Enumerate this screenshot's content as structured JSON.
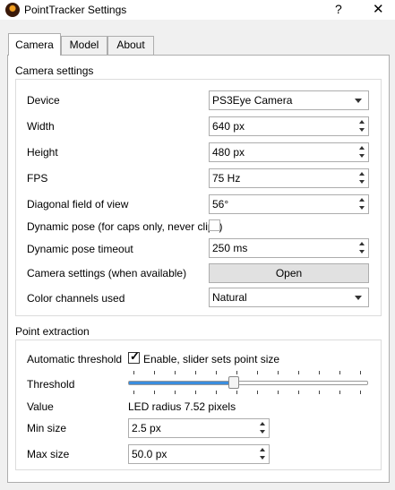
{
  "window": {
    "title": "PointTracker Settings",
    "help": "?",
    "close": "✕"
  },
  "tabs": [
    "Camera",
    "Model",
    "About"
  ],
  "camera": {
    "group_title": "Camera settings",
    "device": {
      "label": "Device",
      "value": "PS3Eye Camera"
    },
    "width": {
      "label": "Width",
      "value": "640 px"
    },
    "height": {
      "label": "Height",
      "value": "480 px"
    },
    "fps": {
      "label": "FPS",
      "value": "75 Hz"
    },
    "fov": {
      "label": "Diagonal field of view",
      "value": "56°"
    },
    "dynamic_pose": {
      "label": "Dynamic pose (for caps only, never clips)",
      "checked": false
    },
    "dynamic_pose_timeout": {
      "label": "Dynamic pose timeout",
      "value": "250 ms"
    },
    "camera_settings": {
      "label": "Camera settings (when available)",
      "button": "Open"
    },
    "color_channels": {
      "label": "Color channels used",
      "value": "Natural"
    }
  },
  "point_extraction": {
    "group_title": "Point extraction",
    "auto_threshold": {
      "label": "Automatic threshold",
      "checkbox_label": "Enable, slider sets point size",
      "checked": true
    },
    "threshold": {
      "label": "Threshold",
      "fraction": 0.44
    },
    "value": {
      "label": "Value",
      "text": "LED radius 7.52 pixels"
    },
    "min_size": {
      "label": "Min size",
      "value": "2.5 px"
    },
    "max_size": {
      "label": "Max size",
      "value": "50.0 px"
    }
  },
  "colors": {
    "accent": "#3b8ede",
    "border": "#adadad"
  }
}
